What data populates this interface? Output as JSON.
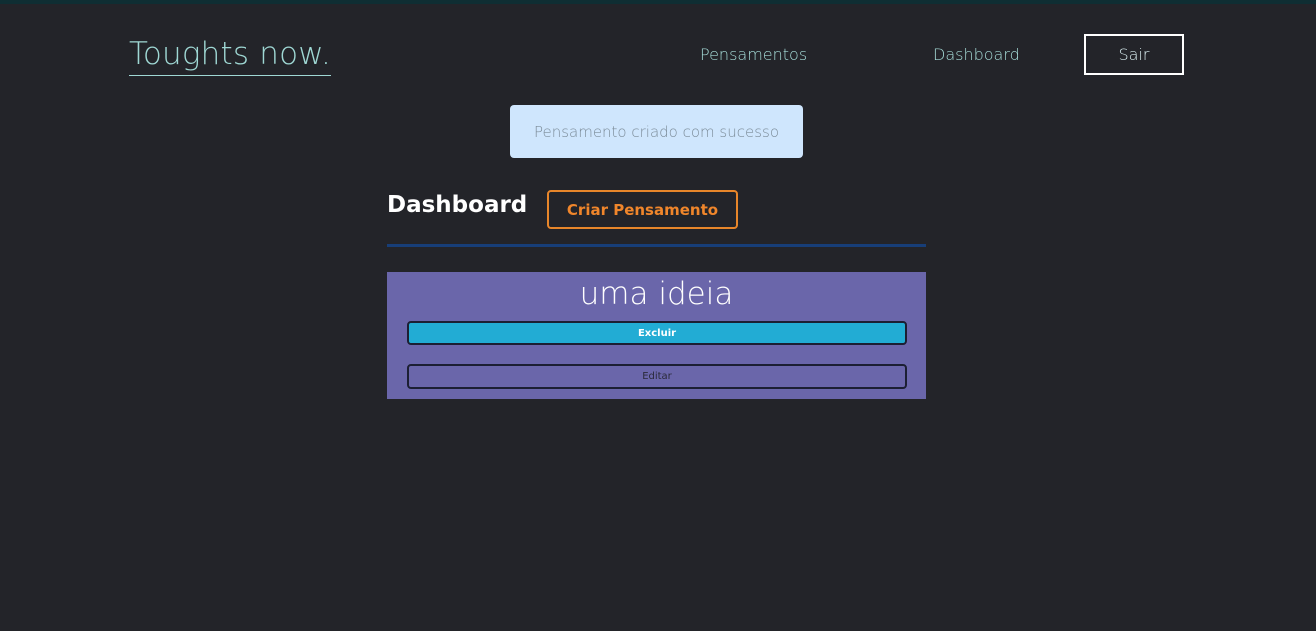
{
  "navbar": {
    "logo": "Toughts now.",
    "links": [
      {
        "label": "Pensamentos"
      },
      {
        "label": "Dashboard"
      }
    ],
    "logout_label": "Sair"
  },
  "flash": {
    "message": "Pensamento criado com sucesso"
  },
  "dashboard": {
    "title": "Dashboard",
    "create_label": "Criar Pensamento"
  },
  "thoughts": [
    {
      "title": "uma ideia",
      "delete_label": "Excluir",
      "edit_label": "Editar"
    }
  ],
  "colors": {
    "background": "#232429",
    "accent_teal": "#9fd8d4",
    "accent_orange": "#f0862b",
    "flash_bg": "#cfe6fd",
    "card_bg": "#6a66aa",
    "delete_bg": "#22acd4",
    "divider": "#173e78"
  }
}
